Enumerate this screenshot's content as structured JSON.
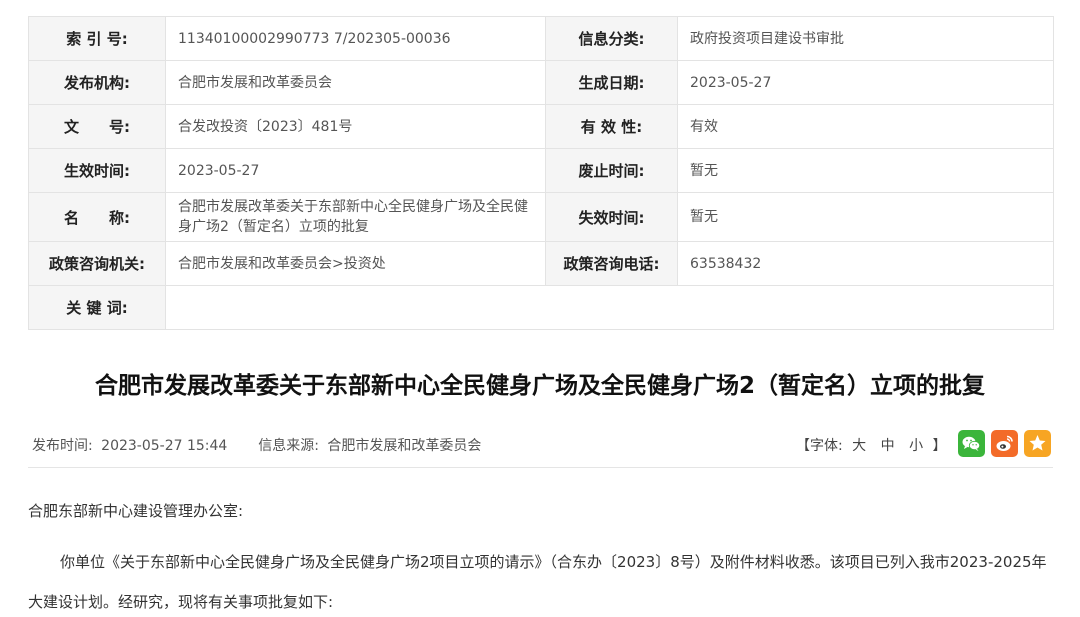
{
  "meta": {
    "rows": [
      [
        {
          "label": "索 引 号:",
          "value": "11340100002990773 7/202305-00036"
        },
        {
          "label": "信息分类:",
          "value": "政府投资项目建设书审批"
        }
      ],
      [
        {
          "label": "发布机构:",
          "value": "合肥市发展和改革委员会"
        },
        {
          "label": "生成日期:",
          "value": "2023-05-27"
        }
      ],
      [
        {
          "label": "文　　号:",
          "value": "合发改投资〔2023〕481号"
        },
        {
          "label": "有 效 性:",
          "value": "有效"
        }
      ],
      [
        {
          "label": "生效时间:",
          "value": "2023-05-27"
        },
        {
          "label": "废止时间:",
          "value": "暂无"
        }
      ],
      [
        {
          "label": "名　　称:",
          "value": "合肥市发展改革委关于东部新中心全民健身广场及全民健身广场2（暂定名）立项的批复"
        },
        {
          "label": "失效时间:",
          "value": "暂无"
        }
      ],
      [
        {
          "label": "政策咨询机关:",
          "value": "合肥市发展和改革委员会>投资处"
        },
        {
          "label": "政策咨询电话:",
          "value": "63538432"
        }
      ],
      [
        {
          "label": "关 键 词:",
          "value": ""
        }
      ]
    ]
  },
  "article": {
    "title": "合肥市发展改革委关于东部新中心全民健身广场及全民健身广场2（暂定名）立项的批复",
    "publish_label": "发布时间:",
    "publish_time": "2023-05-27 15:44",
    "source_label": "信息来源:",
    "source": "合肥市发展和改革委员会",
    "font_label_open": "【字体:",
    "font_large": "大",
    "font_medium": "中",
    "font_small": "小",
    "font_label_close": "】",
    "recipient": "合肥东部新中心建设管理办公室:",
    "paragraph1": "你单位《关于东部新中心全民健身广场及全民健身广场2项目立项的请示》（合东办〔2023〕8号）及附件材料收悉。该项目已列入我市2023-2025年大建设计划。经研究，现将有关事项批复如下:"
  },
  "share_icons": [
    "wechat-icon",
    "weibo-icon",
    "favorite-icon"
  ],
  "colors": {
    "wechat": "#3bb53b",
    "weibo": "#f36b29",
    "favorite": "#f7a523"
  }
}
